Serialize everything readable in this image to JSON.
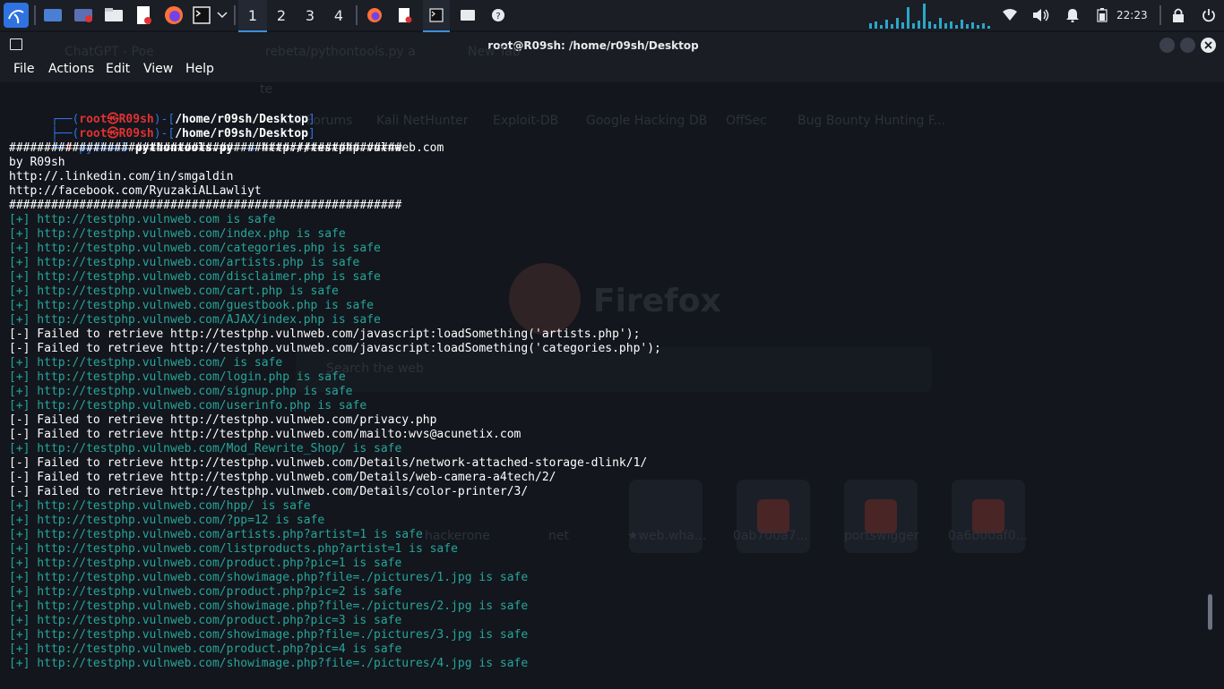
{
  "taskbar": {
    "workspaces": [
      "1",
      "2",
      "3",
      "4"
    ],
    "clock": "22:23"
  },
  "window": {
    "title": "root@R09sh: /home/r09sh/Desktop",
    "menu": [
      "File",
      "Actions",
      "Edit",
      "View",
      "Help"
    ]
  },
  "ghost": {
    "tabs": [
      "ChatGPT - Poe",
      "rebeta/pythontools.py a",
      "New Tab"
    ],
    "url": "te",
    "bookmarks": [
      "Kali Forums",
      "Kali NetHunter",
      "Exploit-DB",
      "Google Hacking DB",
      "OffSec",
      "Bug Bounty Hunting F..."
    ],
    "logo": "Firefox",
    "search": "Search the web",
    "tiles": [
      "hackerone",
      "net",
      "★web.wha...",
      "0ab700a7...",
      "portswigger",
      "0a6b00af0..."
    ]
  },
  "prompt": {
    "user": "root㉿R09sh",
    "path": "/home/r09sh/Desktop",
    "command": "python3",
    "script": "pythontools.py",
    "flag": "-u",
    "argument": "http://testphp.vulnweb.com"
  },
  "banner": {
    "rule": "########################################################",
    "author": "by R09sh",
    "links": [
      "http://.linkedin.com/in/smgaldin",
      "http://facebook.com/RyuzakiALLawliyt"
    ]
  },
  "results": [
    {
      "type": "safe",
      "text": "[+] http://testphp.vulnweb.com is safe"
    },
    {
      "type": "safe",
      "text": "[+] http://testphp.vulnweb.com/index.php is safe"
    },
    {
      "type": "safe",
      "text": "[+] http://testphp.vulnweb.com/categories.php is safe"
    },
    {
      "type": "safe",
      "text": "[+] http://testphp.vulnweb.com/artists.php is safe"
    },
    {
      "type": "safe",
      "text": "[+] http://testphp.vulnweb.com/disclaimer.php is safe"
    },
    {
      "type": "safe",
      "text": "[+] http://testphp.vulnweb.com/cart.php is safe"
    },
    {
      "type": "safe",
      "text": "[+] http://testphp.vulnweb.com/guestbook.php is safe"
    },
    {
      "type": "safe",
      "text": "[+] http://testphp.vulnweb.com/AJAX/index.php is safe"
    },
    {
      "type": "fail",
      "text": "[-] Failed to retrieve http://testphp.vulnweb.com/javascript:loadSomething('artists.php');"
    },
    {
      "type": "fail",
      "text": "[-] Failed to retrieve http://testphp.vulnweb.com/javascript:loadSomething('categories.php');"
    },
    {
      "type": "safe",
      "text": "[+] http://testphp.vulnweb.com/ is safe"
    },
    {
      "type": "safe",
      "text": "[+] http://testphp.vulnweb.com/login.php is safe"
    },
    {
      "type": "safe",
      "text": "[+] http://testphp.vulnweb.com/signup.php is safe"
    },
    {
      "type": "safe",
      "text": "[+] http://testphp.vulnweb.com/userinfo.php is safe"
    },
    {
      "type": "fail",
      "text": "[-] Failed to retrieve http://testphp.vulnweb.com/privacy.php"
    },
    {
      "type": "fail",
      "text": "[-] Failed to retrieve http://testphp.vulnweb.com/mailto:wvs@acunetix.com"
    },
    {
      "type": "safe",
      "text": "[+] http://testphp.vulnweb.com/Mod_Rewrite_Shop/ is safe"
    },
    {
      "type": "fail",
      "text": "[-] Failed to retrieve http://testphp.vulnweb.com/Details/network-attached-storage-dlink/1/"
    },
    {
      "type": "fail",
      "text": "[-] Failed to retrieve http://testphp.vulnweb.com/Details/web-camera-a4tech/2/"
    },
    {
      "type": "fail",
      "text": "[-] Failed to retrieve http://testphp.vulnweb.com/Details/color-printer/3/"
    },
    {
      "type": "safe",
      "text": "[+] http://testphp.vulnweb.com/hpp/ is safe"
    },
    {
      "type": "safe",
      "text": "[+] http://testphp.vulnweb.com/?pp=12 is safe"
    },
    {
      "type": "safe",
      "text": "[+] http://testphp.vulnweb.com/artists.php?artist=1 is safe"
    },
    {
      "type": "safe",
      "text": "[+] http://testphp.vulnweb.com/listproducts.php?artist=1 is safe"
    },
    {
      "type": "safe",
      "text": "[+] http://testphp.vulnweb.com/product.php?pic=1 is safe"
    },
    {
      "type": "safe",
      "text": "[+] http://testphp.vulnweb.com/showimage.php?file=./pictures/1.jpg is safe"
    },
    {
      "type": "safe",
      "text": "[+] http://testphp.vulnweb.com/product.php?pic=2 is safe"
    },
    {
      "type": "safe",
      "text": "[+] http://testphp.vulnweb.com/showimage.php?file=./pictures/2.jpg is safe"
    },
    {
      "type": "safe",
      "text": "[+] http://testphp.vulnweb.com/product.php?pic=3 is safe"
    },
    {
      "type": "safe",
      "text": "[+] http://testphp.vulnweb.com/showimage.php?file=./pictures/3.jpg is safe"
    },
    {
      "type": "safe",
      "text": "[+] http://testphp.vulnweb.com/product.php?pic=4 is safe"
    },
    {
      "type": "safe",
      "text": "[+] http://testphp.vulnweb.com/showimage.php?file=./pictures/4.jpg is safe"
    }
  ],
  "colors": {
    "safe": "#26a69a",
    "fail": "#ffffff",
    "prompt_frame": "#2f73e0",
    "prompt_user": "#e03232",
    "accent": "#3d8fdc"
  },
  "icons": [
    "kali-menu-icon",
    "desktop-icon",
    "screen-recorder-icon",
    "file-manager-icon",
    "text-editor-icon",
    "firefox-icon",
    "terminal-icon",
    "chevron-down-icon",
    "wifi-icon",
    "volume-icon",
    "bell-icon",
    "battery-icon",
    "lock-icon",
    "power-icon",
    "close-icon"
  ]
}
